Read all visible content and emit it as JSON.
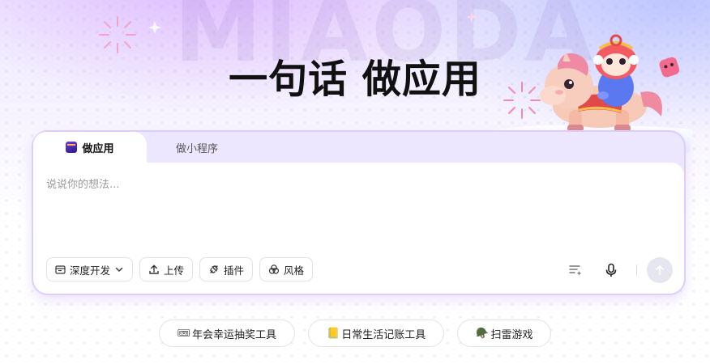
{
  "brand_watermark": "MIAODA",
  "headline": "一句话 做应用",
  "tabs": [
    {
      "label": "做应用",
      "active": true,
      "icon": "app-build-icon"
    },
    {
      "label": "做小程序",
      "active": false
    }
  ],
  "prompt": {
    "placeholder": "说说你的想法...",
    "value": ""
  },
  "toolbar": {
    "mode": {
      "label": "深度开发",
      "icon": "window-icon",
      "dropdown": true
    },
    "upload": {
      "label": "上传",
      "icon": "upload-icon"
    },
    "plugins": {
      "label": "插件",
      "icon": "plugin-icon"
    },
    "style": {
      "label": "风格",
      "icon": "palette-icon"
    }
  },
  "right_tools": [
    "prompt-optimize-icon",
    "microphone-icon",
    "send-arrow-icon"
  ],
  "suggestions": [
    {
      "emoji": "🎟",
      "text": "年会幸运抽奖工具",
      "icon": "ticket-icon"
    },
    {
      "emoji": "📒",
      "text": "日常生活记账工具",
      "icon": "notebook-icon"
    },
    {
      "emoji": "🪖",
      "text": "扫雷游戏",
      "icon": "helmet-icon"
    }
  ],
  "colors": {
    "accent": "#7b4dff",
    "chip_border": "#e2e2ea",
    "panel_glow": "#dccdff"
  }
}
